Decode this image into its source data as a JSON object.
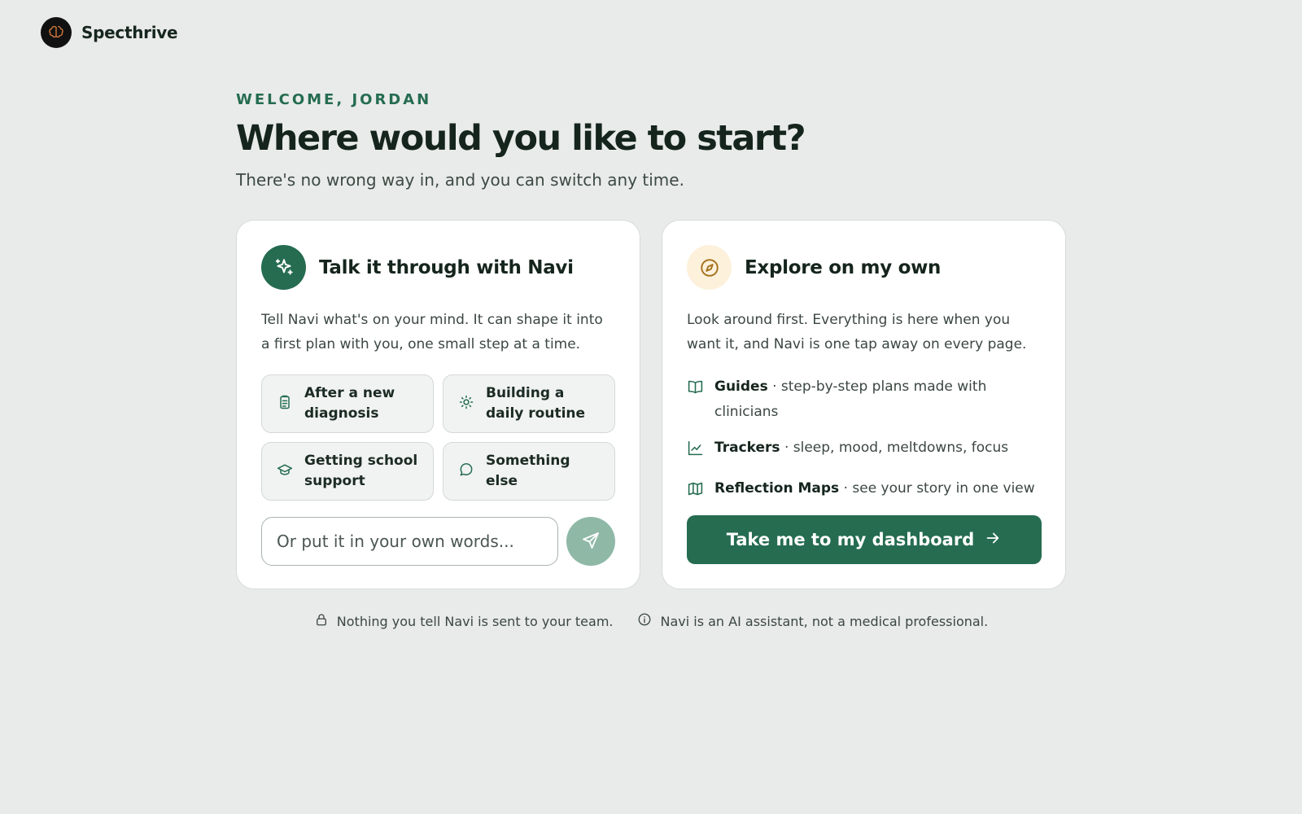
{
  "brand": {
    "name": "Specthrive",
    "logo_icon": "brain-logo-icon"
  },
  "hero": {
    "eyebrow": "WELCOME, JORDAN",
    "headline": "Where would you like to start?",
    "subtitle": "There's no wrong way in, and you can switch any time."
  },
  "navi_card": {
    "title": "Talk it through with Navi",
    "icon": "sparkle-icon",
    "description": "Tell Navi what's on your mind. It can shape it into a first plan with you, one small step at a time.",
    "chips": [
      {
        "label": "After a new diagnosis",
        "icon": "clipboard-icon"
      },
      {
        "label": "Building a daily routine",
        "icon": "sun-icon"
      },
      {
        "label": "Getting school support",
        "icon": "graduation-cap-icon"
      },
      {
        "label": "Something else",
        "icon": "chat-bubble-icon"
      }
    ],
    "input_placeholder": "Or put it in your own words...",
    "send_icon": "send-icon"
  },
  "explore_card": {
    "title": "Explore on my own",
    "icon": "compass-icon",
    "description": "Look around first. Everything is here when you want it, and Navi is one tap away on every page.",
    "features": [
      {
        "name": "Guides",
        "detail": " · step-by-step plans made with clinicians",
        "icon": "book-icon"
      },
      {
        "name": "Trackers",
        "detail": " · sleep, mood, meltdowns, focus",
        "icon": "line-chart-icon"
      },
      {
        "name": "Reflection Maps",
        "detail": " · see your story in one view",
        "icon": "map-icon"
      }
    ],
    "button_label": "Take me to my dashboard",
    "button_icon": "arrow-right-icon"
  },
  "footer": {
    "privacy_note": "Nothing you tell Navi is sent to your team.",
    "disclaimer": "Navi is an AI assistant, not a medical professional."
  },
  "colors": {
    "accent": "#256c51",
    "background": "#e9ebea",
    "send_button": "#8fb8a7",
    "compass_bg": "#fdf1dc",
    "compass_stroke": "#a5731f"
  }
}
